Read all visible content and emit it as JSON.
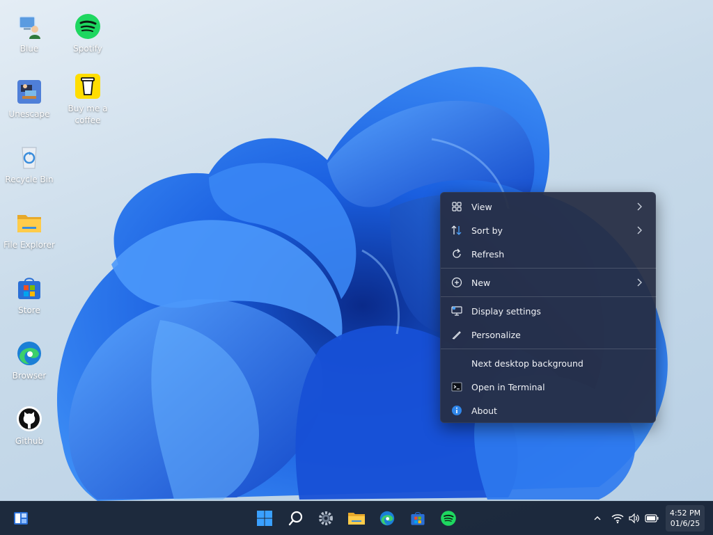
{
  "desktop": {
    "icons": [
      {
        "label": "Blue"
      },
      {
        "label": "Spotify"
      },
      {
        "label": "Unescape"
      },
      {
        "label": "Buy me a coffee"
      },
      {
        "label": "Recycle Bin"
      },
      {
        "label": "File Explorer"
      },
      {
        "label": "Store"
      },
      {
        "label": "Browser"
      },
      {
        "label": "Github"
      }
    ]
  },
  "context_menu": {
    "items": [
      {
        "label": "View",
        "icon": "grid-icon",
        "submenu": true
      },
      {
        "label": "Sort by",
        "icon": "sort-icon",
        "submenu": true
      },
      {
        "label": "Refresh",
        "icon": "refresh-icon",
        "submenu": false
      },
      {
        "label": "New",
        "icon": "plus-circle-icon",
        "submenu": true
      },
      {
        "label": "Display settings",
        "icon": "display-icon",
        "submenu": false
      },
      {
        "label": "Personalize",
        "icon": "pen-icon",
        "submenu": false
      },
      {
        "label": "Next desktop background",
        "icon": "",
        "submenu": false
      },
      {
        "label": "Open in Terminal",
        "icon": "terminal-icon",
        "submenu": false
      },
      {
        "label": "About",
        "icon": "info-icon",
        "submenu": false
      }
    ]
  },
  "taskbar": {
    "clock": {
      "time": "4:52 PM",
      "date": "01/6/25"
    }
  },
  "colors": {
    "accent": "#1f6fe0",
    "menu_bg": "#262e44",
    "taskbar_bg": "#162236",
    "spotify": "#1ed760"
  }
}
